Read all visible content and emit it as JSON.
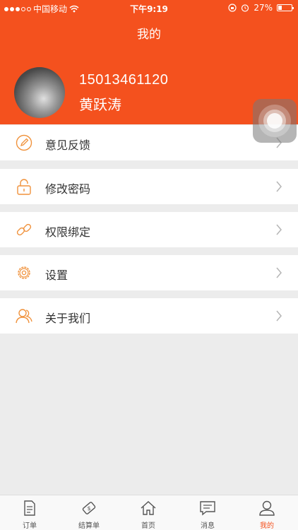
{
  "status_bar": {
    "carrier": "中国移动",
    "time": "下午9:19",
    "battery": "27%",
    "battery_level": 0.27
  },
  "header": {
    "title": "我的",
    "phone": "15013461120",
    "name": "黄跃涛"
  },
  "menu": [
    {
      "label": "意见反馈",
      "icon": "edit-pencil-icon"
    },
    {
      "label": "修改密码",
      "icon": "lock-icon"
    },
    {
      "label": "权限绑定",
      "icon": "link-icon"
    },
    {
      "label": "设置",
      "icon": "gear-icon"
    },
    {
      "label": "关于我们",
      "icon": "users-icon"
    }
  ],
  "tabbar": [
    {
      "label": "订单",
      "icon": "document-icon"
    },
    {
      "label": "结算单",
      "icon": "ticket-icon"
    },
    {
      "label": "首页",
      "icon": "home-icon"
    },
    {
      "label": "消息",
      "icon": "message-icon"
    },
    {
      "label": "我的",
      "icon": "person-icon",
      "active": true
    }
  ],
  "colors": {
    "accent": "#f4511e",
    "icon_orange": "#f0923c",
    "background": "#ececec"
  }
}
